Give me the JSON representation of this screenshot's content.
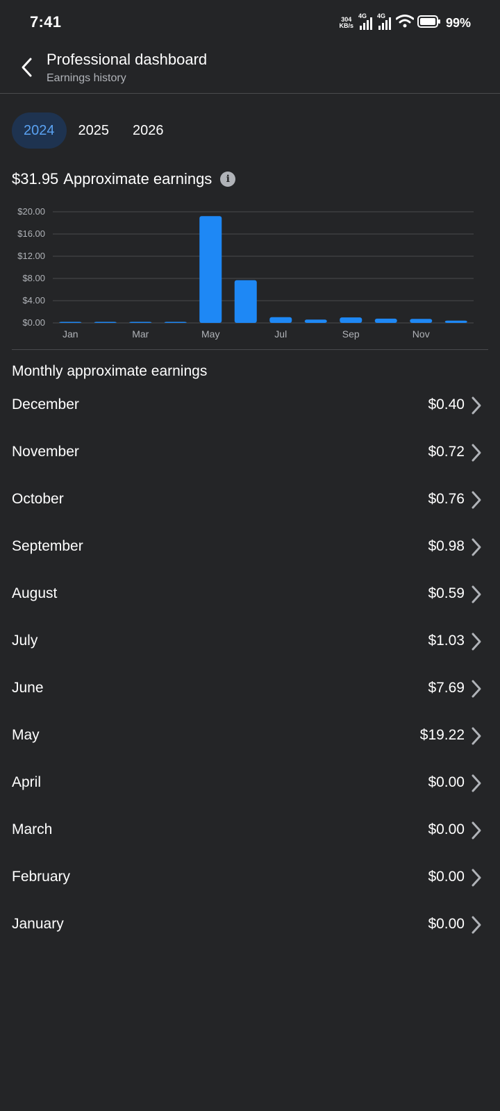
{
  "status_bar": {
    "time": "7:41",
    "net_speed_value": "304",
    "net_speed_unit": "KB/s",
    "signal1_label": "4G",
    "signal2_label": "4G",
    "battery": "99%"
  },
  "header": {
    "title": "Professional dashboard",
    "subtitle": "Earnings history"
  },
  "year_tabs": [
    {
      "label": "2024",
      "active": true
    },
    {
      "label": "2025",
      "active": false
    },
    {
      "label": "2026",
      "active": false
    }
  ],
  "summary": {
    "amount": "$31.95",
    "label": "Approximate earnings"
  },
  "colors": {
    "background": "#242527",
    "bar": "#1e88f5",
    "active_tab_bg": "#1e3350",
    "active_tab_text": "#5aa2f2",
    "gridline": "#4a4b4e"
  },
  "chart_data": {
    "type": "bar",
    "categories": [
      "Jan",
      "Feb",
      "Mar",
      "Apr",
      "May",
      "Jun",
      "Jul",
      "Aug",
      "Sep",
      "Oct",
      "Nov",
      "Dec"
    ],
    "x_tick_labels": [
      "Jan",
      "Mar",
      "May",
      "Jul",
      "Sep",
      "Nov"
    ],
    "values": [
      0.0,
      0.0,
      0.0,
      0.0,
      19.22,
      7.69,
      1.03,
      0.59,
      0.98,
      0.76,
      0.72,
      0.4
    ],
    "y_ticks": [
      "$0.00",
      "$4.00",
      "$8.00",
      "$12.00",
      "$16.00",
      "$20.00"
    ],
    "ylim": [
      0,
      20
    ],
    "grid": true
  },
  "list": {
    "title": "Monthly approximate earnings",
    "items": [
      {
        "month": "December",
        "value": "$0.40"
      },
      {
        "month": "November",
        "value": "$0.72"
      },
      {
        "month": "October",
        "value": "$0.76"
      },
      {
        "month": "September",
        "value": "$0.98"
      },
      {
        "month": "August",
        "value": "$0.59"
      },
      {
        "month": "July",
        "value": "$1.03"
      },
      {
        "month": "June",
        "value": "$7.69"
      },
      {
        "month": "May",
        "value": "$19.22"
      },
      {
        "month": "April",
        "value": "$0.00"
      },
      {
        "month": "March",
        "value": "$0.00"
      },
      {
        "month": "February",
        "value": "$0.00"
      },
      {
        "month": "January",
        "value": "$0.00"
      }
    ]
  }
}
